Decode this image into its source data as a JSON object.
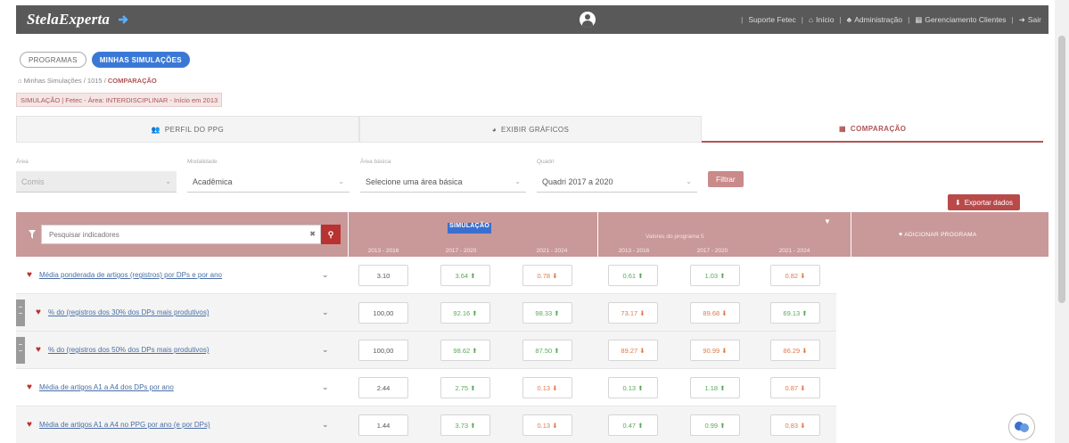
{
  "header": {
    "logo_text": "StelaExperta",
    "nav": [
      {
        "label": "Suporte Fetec",
        "icon": "none"
      },
      {
        "label": "Início",
        "icon": "home-icon"
      },
      {
        "label": "Administração",
        "icon": "admin-icon"
      },
      {
        "label": "Gerenciamento Clientes",
        "icon": "building-icon"
      },
      {
        "label": "Sair",
        "icon": "logout-icon"
      }
    ]
  },
  "pills": {
    "programas": "PROGRAMAS",
    "minhas_simulacoes": "MINHAS SIMULAÇÕES"
  },
  "breadcrumb": {
    "root": "Minhas Simulações",
    "middle": "1015",
    "current": "COMPARAÇÃO"
  },
  "simulation_label": "SIMULAÇÃO | Fetec - Área: INTERDISCIPLINAR - Início em 2013",
  "tabs": [
    {
      "label": "PERFIL DO PPG",
      "icon": "users-icon"
    },
    {
      "label": "EXIBIR GRÁFICOS",
      "icon": "pie-icon"
    },
    {
      "label": "COMPARAÇÃO",
      "icon": "table-icon"
    }
  ],
  "filters": {
    "area": {
      "label": "Área",
      "value": "Comis"
    },
    "modalidade": {
      "label": "Modalidade",
      "value": "Acadêmica"
    },
    "area_basica": {
      "label": "Área básica",
      "value": "Selecione uma área básica"
    },
    "quadrienio": {
      "label": "Quadri",
      "value": "Quadri 2017 a 2020"
    },
    "filtrar_label": "Filtrar"
  },
  "export_label": "Exportar dados",
  "table": {
    "search_placeholder": "Pesquisar indicadores",
    "simulacao_title": "SIMULAÇÃO",
    "group_title": "Valores do programa 5",
    "add_program_label": "ADICIONAR PROGRAMA",
    "periods": [
      "2013 - 2016",
      "2017 - 2020",
      "2021 - 2024",
      "2013 - 2016",
      "2017 - 2020",
      "2021 - 2024"
    ]
  },
  "rows": [
    {
      "name": "Média ponderada de artigos (registros) por DPs e por ano",
      "grip": false,
      "values": [
        "3.10",
        "3.64",
        "0.78",
        "0.61",
        "1.03",
        "0.82"
      ],
      "trend": [
        "",
        "up",
        "down",
        "up",
        "up",
        "down"
      ]
    },
    {
      "name": "% do (registros dos 30% dos DPs mais produtivos)",
      "grip": true,
      "values": [
        "100,00",
        "92.16",
        "98.33",
        "73.17",
        "89.68",
        "69.13"
      ],
      "trend": [
        "",
        "up",
        "up",
        "down",
        "down",
        "up"
      ]
    },
    {
      "name": "% do (registros dos 50% dos DPs mais produtivos)",
      "grip": true,
      "values": [
        "100,00",
        "98.62",
        "87.50",
        "89.27",
        "90.99",
        "86.29"
      ],
      "trend": [
        "",
        "up",
        "up",
        "down",
        "down",
        "down"
      ]
    },
    {
      "name": "Média de artigos A1 a A4 dos DPs por ano",
      "grip": false,
      "values": [
        "2.44",
        "2.75",
        "0.13",
        "0.13",
        "1.18",
        "0.87"
      ],
      "trend": [
        "",
        "up",
        "down",
        "up",
        "up",
        "down"
      ]
    },
    {
      "name": "Média de artigos A1 a A4 no PPG por ano (e por DPs)",
      "grip": false,
      "values": [
        "1.44",
        "3.73",
        "0.13",
        "0.47",
        "0.99",
        "0.83"
      ],
      "trend": [
        "",
        "up",
        "down",
        "up",
        "up",
        "down"
      ]
    }
  ]
}
